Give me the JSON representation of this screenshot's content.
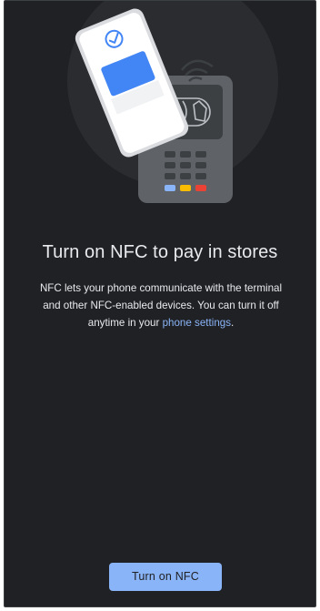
{
  "screen": {
    "headline": "Turn on NFC to pay in stores",
    "body_text": "NFC lets your phone communicate with the terminal and other NFC-enabled devices. You can turn it off anytime in your",
    "body_link": "phone settings",
    "body_end": ".",
    "primary_button": "Turn on NFC"
  },
  "illustration": {
    "icons": [
      "phone-icon",
      "check-icon",
      "card-icon",
      "payment-terminal-icon",
      "contactless-icon",
      "hand-icon"
    ],
    "colors": {
      "background": "#202124",
      "accent_blue": "#8ab4f8",
      "card_blue": "#4285f4",
      "terminal_yellow": "#fbbc04",
      "terminal_red": "#ea4335"
    }
  }
}
